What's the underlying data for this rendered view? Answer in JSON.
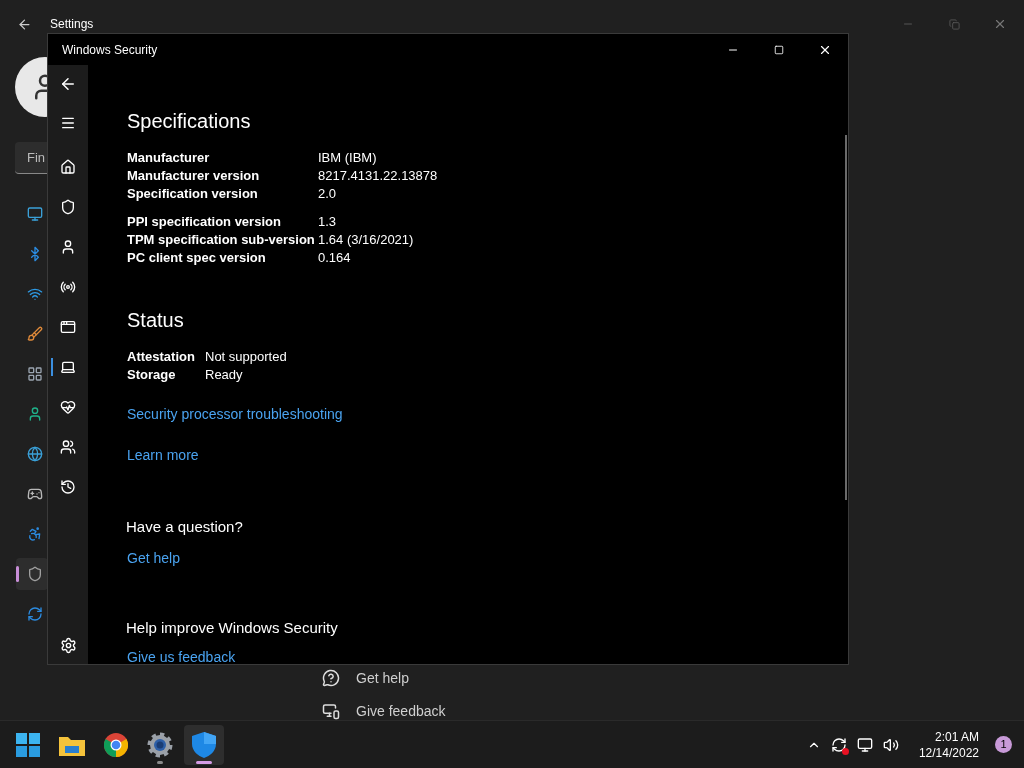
{
  "settings_window": {
    "title": "Settings",
    "search": {
      "placeholder": "Fin"
    },
    "nav": [
      {
        "selected": false
      },
      {
        "selected": false
      },
      {
        "selected": false
      },
      {
        "selected": false
      },
      {
        "selected": false
      },
      {
        "selected": false
      },
      {
        "selected": false
      },
      {
        "selected": false
      },
      {
        "selected": false
      },
      {
        "selected": true
      },
      {
        "selected": false
      }
    ],
    "links": [
      "Get help",
      "Give feedback"
    ]
  },
  "security_window": {
    "title": "Windows Security",
    "nav": [
      {
        "selected": false
      },
      {
        "selected": false
      },
      {
        "selected": false
      },
      {
        "selected": false
      },
      {
        "selected": false
      },
      {
        "selected": true
      },
      {
        "selected": false
      },
      {
        "selected": false
      },
      {
        "selected": false
      }
    ],
    "specifications": {
      "heading": "Specifications",
      "groups": [
        [
          {
            "label": "Manufacturer",
            "value": "IBM (IBM)"
          },
          {
            "label": "Manufacturer version",
            "value": "8217.4131.22.13878"
          },
          {
            "label": "Specification version",
            "value": "2.0"
          }
        ],
        [
          {
            "label": "PPI specification version",
            "value": "1.3"
          },
          {
            "label": "TPM specification sub-version",
            "value": "1.64 (3/16/2021)"
          },
          {
            "label": "PC client spec version",
            "value": "0.164"
          }
        ]
      ]
    },
    "status": {
      "heading": "Status",
      "rows": [
        {
          "label": "Attestation",
          "value": "Not supported"
        },
        {
          "label": "Storage",
          "value": "Ready"
        }
      ],
      "links": [
        "Security processor troubleshooting",
        "Learn more"
      ]
    },
    "question": {
      "heading": "Have a question?",
      "link": "Get help"
    },
    "improve": {
      "heading": "Help improve Windows Security",
      "link": "Give us feedback"
    }
  },
  "taskbar": {
    "apps": [
      {
        "running": false,
        "selected": false
      },
      {
        "running": false,
        "selected": false
      },
      {
        "running": false,
        "selected": false
      },
      {
        "running": true,
        "selected": false
      },
      {
        "running": true,
        "selected": true
      }
    ],
    "time": "2:01 AM",
    "date": "12/14/2022",
    "notifications": "1"
  }
}
